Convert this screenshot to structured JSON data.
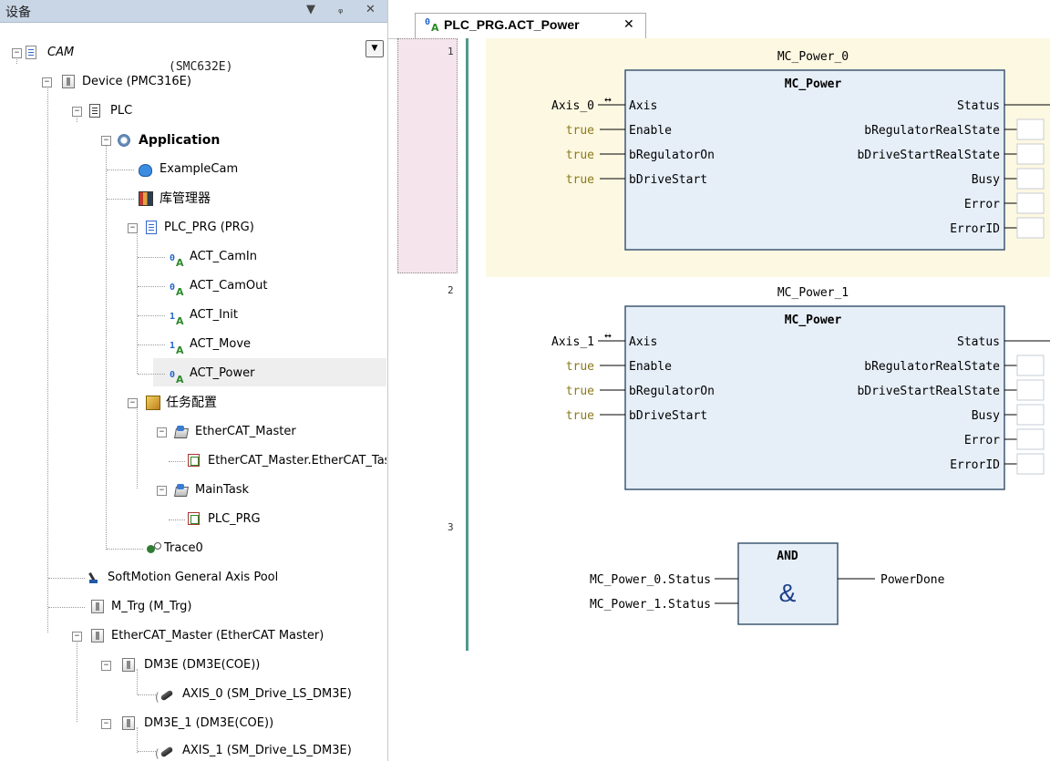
{
  "panel": {
    "title": "设备",
    "dropdown_icon": "▼",
    "pin_icon": "ᵩ",
    "close_icon": "✕",
    "selector_glyph": "▼"
  },
  "device_overlay": "(SMC632E)",
  "tree": [
    {
      "label": "CAM",
      "italic": true
    },
    {
      "label": "Device (PMC316E)"
    },
    {
      "label": "PLC"
    },
    {
      "label": "Application",
      "bold": true
    },
    {
      "label": "ExampleCam"
    },
    {
      "label": "库管理器"
    },
    {
      "label": "PLC_PRG (PRG)"
    },
    {
      "label": "ACT_CamIn"
    },
    {
      "label": "ACT_CamOut"
    },
    {
      "label": "ACT_Init"
    },
    {
      "label": "ACT_Move"
    },
    {
      "label": "ACT_Power",
      "selected": true
    },
    {
      "label": "任务配置"
    },
    {
      "label": "EtherCAT_Master"
    },
    {
      "label": "EtherCAT_Master.EtherCAT_Task"
    },
    {
      "label": "MainTask"
    },
    {
      "label": "PLC_PRG"
    },
    {
      "label": "Trace0"
    },
    {
      "label": "SoftMotion General Axis Pool"
    },
    {
      "label": "M_Trg (M_Trg)"
    },
    {
      "label": "EtherCAT_Master (EtherCAT Master)"
    },
    {
      "label": "DM3E (DM3E(COE))"
    },
    {
      "label": "AXIS_0 (SM_Drive_LS_DM3E)"
    },
    {
      "label": "DM3E_1 (DM3E(COE))"
    },
    {
      "label": "AXIS_1 (SM_Drive_LS_DM3E)"
    }
  ],
  "editor": {
    "tab_label": "PLC_PRG.ACT_Power",
    "tab_close": "✕",
    "networks": [
      "1",
      "2",
      "3"
    ],
    "fb0": {
      "instance": "MC_Power_0",
      "type": "MC_Power",
      "inputs": [
        "Axis",
        "Enable",
        "bRegulatorOn",
        "bDriveStart"
      ],
      "input_values": [
        "Axis_0",
        "true",
        "true",
        "true"
      ],
      "outputs": [
        "Status",
        "bRegulatorRealState",
        "bDriveStartRealState",
        "Busy",
        "Error",
        "ErrorID"
      ]
    },
    "fb1": {
      "instance": "MC_Power_1",
      "type": "MC_Power",
      "inputs": [
        "Axis",
        "Enable",
        "bRegulatorOn",
        "bDriveStart"
      ],
      "input_values": [
        "Axis_1",
        "true",
        "true",
        "true"
      ],
      "outputs": [
        "Status",
        "bRegulatorRealState",
        "bDriveStartRealState",
        "Busy",
        "Error",
        "ErrorID"
      ]
    },
    "and_block": {
      "title": "AND",
      "symbol": "&",
      "inputs": [
        "MC_Power_0.Status",
        "MC_Power_1.Status"
      ],
      "output": "PowerDone"
    },
    "ref_glyph": "↔",
    "colors": {
      "true_value": "#8a7a1a",
      "fb_fill": "#e6eef8",
      "fb_border": "#3e5873",
      "network_bg": "#fdf8e2",
      "gutter": "#4f9a8c"
    }
  }
}
